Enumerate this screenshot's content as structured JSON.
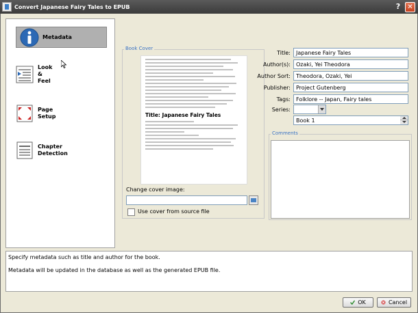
{
  "window": {
    "title": "Convert Japanese Fairy Tales to EPUB"
  },
  "sidebar": {
    "items": [
      {
        "label": "Metadata",
        "icon": "info-icon",
        "active": true
      },
      {
        "label": "Look\n&\nFeel",
        "icon": "text-align-icon"
      },
      {
        "label": "Page\nSetup",
        "icon": "page-setup-icon"
      },
      {
        "label": "Chapter\nDetection",
        "icon": "document-icon"
      }
    ]
  },
  "book_cover": {
    "group_title": "Book Cover",
    "cover_heading": "Title: Japanese Fairy Tales",
    "change_cover_label": "Change cover image:",
    "cover_path_value": "",
    "use_source_cover_label": "Use cover from source file"
  },
  "metadata": {
    "title_label": "Title:",
    "title_value": "Japanese Fairy Tales",
    "authors_label": "Author(s):",
    "authors_value": "Ozaki, Yei Theodora",
    "author_sort_label": "Author Sort:",
    "author_sort_value": "Theodora, Ozaki, Yei",
    "publisher_label": "Publisher:",
    "publisher_value": "Project Gutenberg",
    "tags_label": "Tags:",
    "tags_value": "Folklore -- Japan, Fairy tales",
    "series_label": "Series:",
    "series_value": "",
    "series_index_value": "Book 1"
  },
  "comments": {
    "group_title": "Comments",
    "value": ""
  },
  "description": {
    "line1": "Specify metadata such as title and author for the book.",
    "line2": "Metadata will be updated in the database as well as the generated EPUB file."
  },
  "buttons": {
    "ok_label": "OK",
    "cancel_label": "Cancel"
  },
  "colors": {
    "accent": "#3a72c4",
    "titlebar": "#4a4a4a",
    "close": "#d0532c"
  }
}
